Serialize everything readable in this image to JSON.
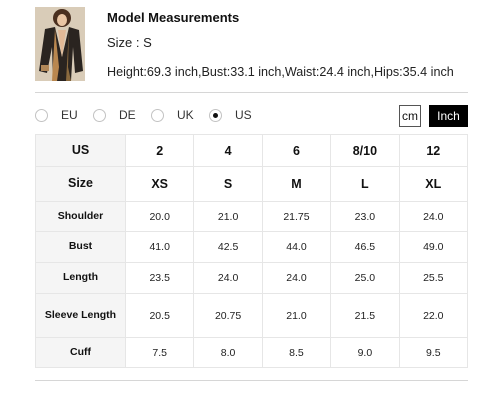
{
  "model": {
    "title": "Model Measurements",
    "size_line": "Size : S",
    "stats": "Height:69.3 inch,Bust:33.1 inch,Waist:24.4 inch,Hips:35.4 inch"
  },
  "region_options": [
    {
      "label": "EU",
      "selected": false
    },
    {
      "label": "DE",
      "selected": false
    },
    {
      "label": "UK",
      "selected": false
    },
    {
      "label": "US",
      "selected": true
    }
  ],
  "unit_toggle": {
    "cm_label": "cm",
    "inch_label": "Inch",
    "active": "Inch"
  },
  "table": {
    "header_us": [
      "US",
      "2",
      "4",
      "6",
      "8/10",
      "12"
    ],
    "header_size": [
      "Size",
      "XS",
      "S",
      "M",
      "L",
      "XL"
    ],
    "rows": [
      {
        "label": "Shoulder",
        "values": [
          "20.0",
          "21.0",
          "21.75",
          "23.0",
          "24.0"
        ]
      },
      {
        "label": "Bust",
        "values": [
          "41.0",
          "42.5",
          "44.0",
          "46.5",
          "49.0"
        ]
      },
      {
        "label": "Length",
        "values": [
          "23.5",
          "24.0",
          "24.0",
          "25.0",
          "25.5"
        ]
      },
      {
        "label": "Sleeve Length",
        "values": [
          "20.5",
          "20.75",
          "21.0",
          "21.5",
          "22.0"
        ]
      },
      {
        "label": "Cuff",
        "values": [
          "7.5",
          "8.0",
          "8.5",
          "9.0",
          "9.5"
        ]
      }
    ]
  }
}
